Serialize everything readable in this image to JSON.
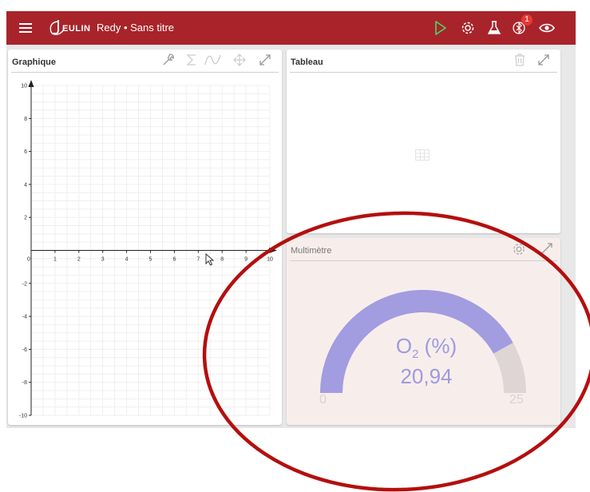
{
  "header": {
    "app_title": "Redy • Sans titre",
    "logo_text": "Jeulin",
    "bluetooth_badge": "1",
    "bg_color": "#a8242a"
  },
  "graph_panel": {
    "title": "Graphique",
    "icons": [
      "wrench-icon",
      "sigma-icon",
      "wave-icon",
      "move-icon",
      "expand-icon"
    ]
  },
  "table_panel": {
    "title": "Tableau",
    "icons": [
      "trash-icon",
      "expand-icon",
      "grid-placeholder-icon"
    ]
  },
  "multimeter_panel": {
    "title": "Multimètre",
    "gauge": {
      "quantity": "O",
      "subscript": "2",
      "unit": " (%)",
      "value_text": "20,94",
      "value": 20.94,
      "min_label": "0",
      "max_label": "25",
      "min": 0,
      "max": 25,
      "fill_color": "#a29ce0",
      "track_color": "#ddd6d4"
    }
  },
  "chart_data": {
    "type": "scatter",
    "title": "",
    "xlabel": "",
    "ylabel": "",
    "xlim": [
      0,
      10
    ],
    "ylim": [
      -10,
      10
    ],
    "grid": true,
    "x_ticks": [
      "0",
      "1",
      "2",
      "3",
      "4",
      "5",
      "6",
      "7",
      "8",
      "9",
      "10"
    ],
    "y_ticks": [
      "10",
      "8",
      "6",
      "4",
      "2",
      "-2",
      "-4",
      "-6",
      "-8",
      "-10"
    ],
    "series": []
  },
  "annotation": {
    "shape": "ellipse",
    "color": "#b40f0f"
  }
}
